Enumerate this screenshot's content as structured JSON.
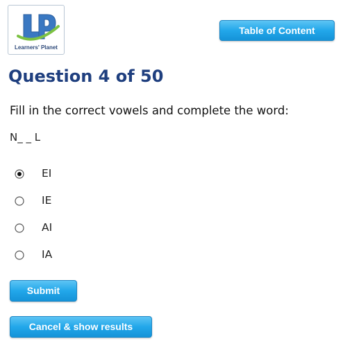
{
  "header": {
    "logo_text": "Learners' Planet",
    "toc_label": "Table of Content"
  },
  "question": {
    "title": "Question 4 of 50",
    "prompt": "Fill in the correct vowels and complete the word:",
    "word": "N_ _ L"
  },
  "options": [
    {
      "label": "EI",
      "selected": true
    },
    {
      "label": "IE",
      "selected": false
    },
    {
      "label": "AI",
      "selected": false
    },
    {
      "label": "IA",
      "selected": false
    }
  ],
  "actions": {
    "submit_label": "Submit",
    "cancel_label": "Cancel & show results"
  },
  "colors": {
    "accent": "#22a7ea",
    "title": "#1f3f7f",
    "logo_blue": "#3a78c2",
    "logo_green": "#7cc243"
  }
}
